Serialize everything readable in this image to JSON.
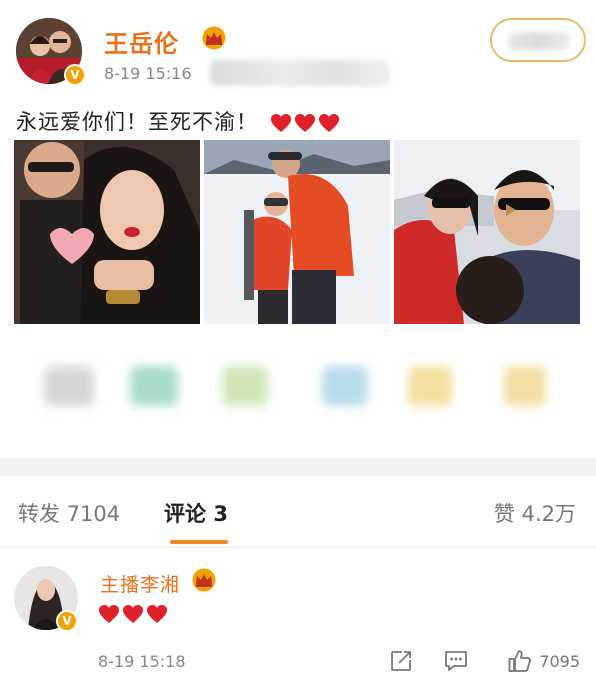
{
  "post": {
    "author": "王岳伦",
    "time": "8-19 15:16",
    "text": "永远爱你们！至死不渝！",
    "verified_badge": "V"
  },
  "tabs": {
    "forward_label": "转发",
    "forward_count": "7104",
    "comments_label": "评论",
    "comments_count": "3",
    "like_label": "赞",
    "like_count": "4.2万"
  },
  "comment": {
    "author": "主播李湘",
    "time": "8-19 15:18",
    "like_count": "7095",
    "verified_badge": "V"
  },
  "icons": {
    "crown": "crown-icon",
    "heart": "heart-icon",
    "repost": "edit-repost-icon",
    "reply": "comment-icon",
    "like": "thumbs-up-icon"
  },
  "colors": {
    "accent_orange": "#e8721c",
    "badge_gold": "#f2a100",
    "heart_red": "#e0202b",
    "tab_indicator": "#f08a24"
  }
}
